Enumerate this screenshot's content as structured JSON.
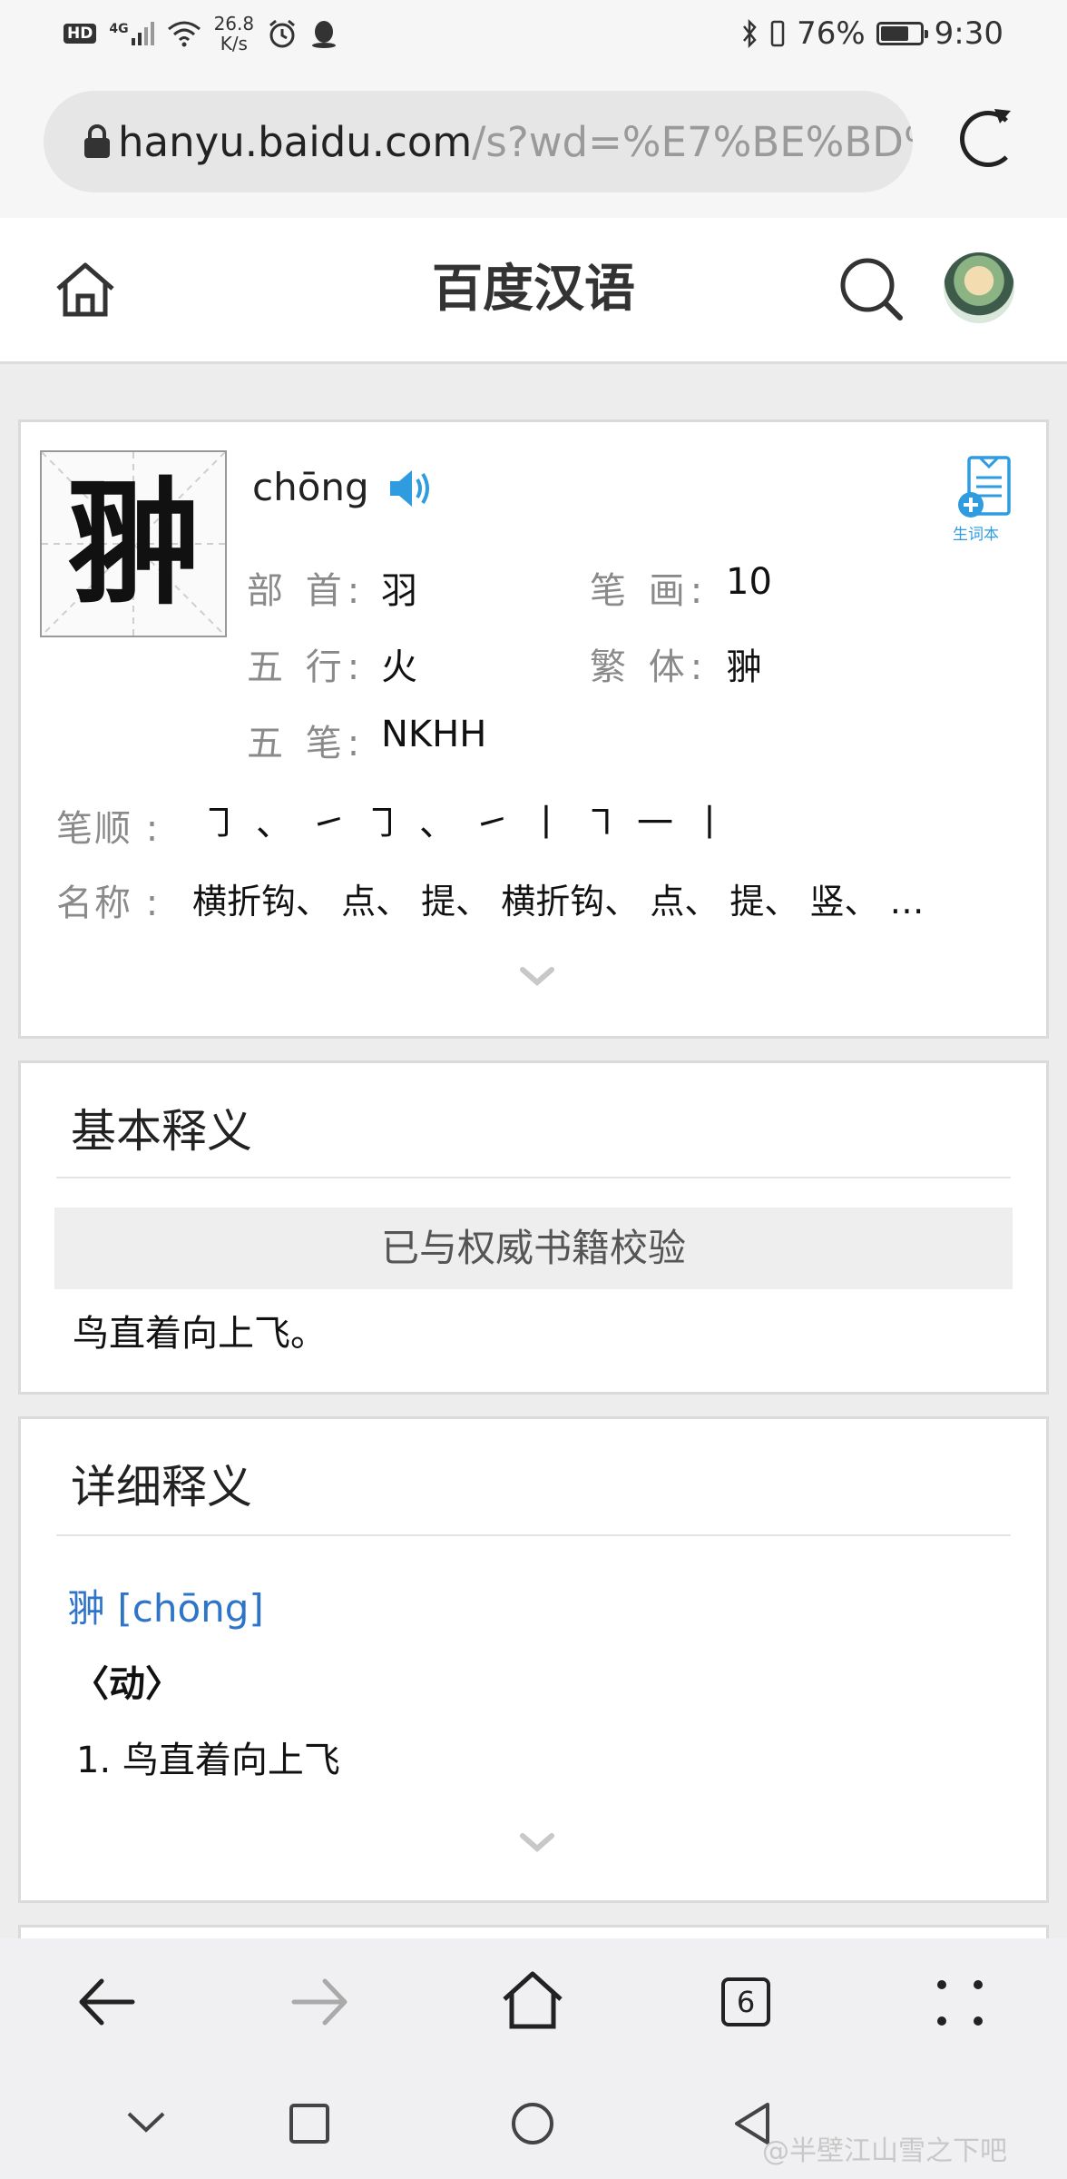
{
  "status": {
    "badge": "HD",
    "network": "4G",
    "speed_value": "26.8",
    "speed_unit": "K/s",
    "battery_text": "76%",
    "battery_level": 0.76,
    "time": "9:30",
    "icons": [
      "signal-icon",
      "wifi-icon",
      "alarm-icon",
      "qq-icon",
      "bluetooth-icon",
      "vibrate-icon",
      "battery-icon"
    ]
  },
  "browser": {
    "url_domain": "hanyu.baidu.com",
    "url_rest": "/s?wd=%E7%BE%BD%",
    "tab_count": "6"
  },
  "header": {
    "title": "百度汉语"
  },
  "entry": {
    "character": "翀",
    "pinyin": "chōng",
    "vocab_label": "生词本",
    "fields": {
      "radical_label": "部 首:",
      "radical": "羽",
      "strokes_label": "笔 画:",
      "strokes": "10",
      "wuxing_label": "五 行:",
      "wuxing": "火",
      "traditional_label": "繁 体:",
      "traditional": "翀",
      "wubi_label": "五 笔:",
      "wubi": "NKHH"
    },
    "order_label": "笔顺 :",
    "stroke_glyphs": [
      "㇆",
      "、",
      "㇀",
      "㇆",
      "、",
      "㇀",
      "丨",
      "㇕",
      "一",
      "丨"
    ],
    "names_label": "名称 :",
    "names_text": "横折钩、 点、 提、 横折钩、 点、 提、 竖、 …"
  },
  "basic": {
    "title": "基本释义",
    "verified": "已与权威书籍校验",
    "definition": "鸟直着向上飞。"
  },
  "detailed": {
    "title": "详细释义",
    "headword": "翀 [chōng]",
    "pos": "〈动〉",
    "item1": "1. 鸟直着向上飞"
  },
  "watermark": "@半壁江山雪之下吧"
}
